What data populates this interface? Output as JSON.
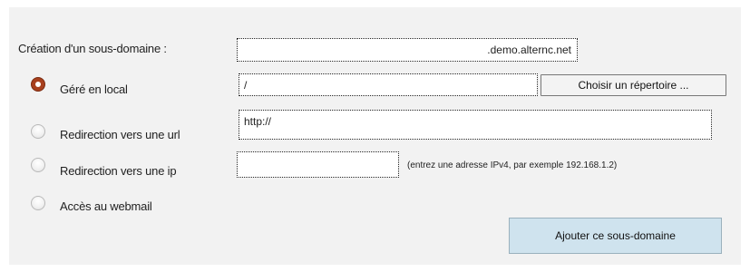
{
  "form": {
    "subdomain_label": "Création d'un sous-domaine :",
    "subdomain_value": ".demo.alternc.net",
    "options": [
      {
        "label": "Géré en local",
        "checked": true,
        "value": "/"
      },
      {
        "label": "Redirection vers une url",
        "checked": false,
        "value": "http://"
      },
      {
        "label": "Redirection vers une ip",
        "checked": false,
        "value": "",
        "hint": "(entrez une adresse IPv4, par exemple 192.168.1.2)"
      },
      {
        "label": "Accès au webmail",
        "checked": false
      }
    ],
    "browse_button": "Choisir un répertoire ...",
    "submit_button": "Ajouter ce sous-domaine"
  },
  "colors": {
    "panel_bg": "#f2f2f2",
    "radio_checked": "#a8401e",
    "submit_bg": "#cfe3ee"
  }
}
